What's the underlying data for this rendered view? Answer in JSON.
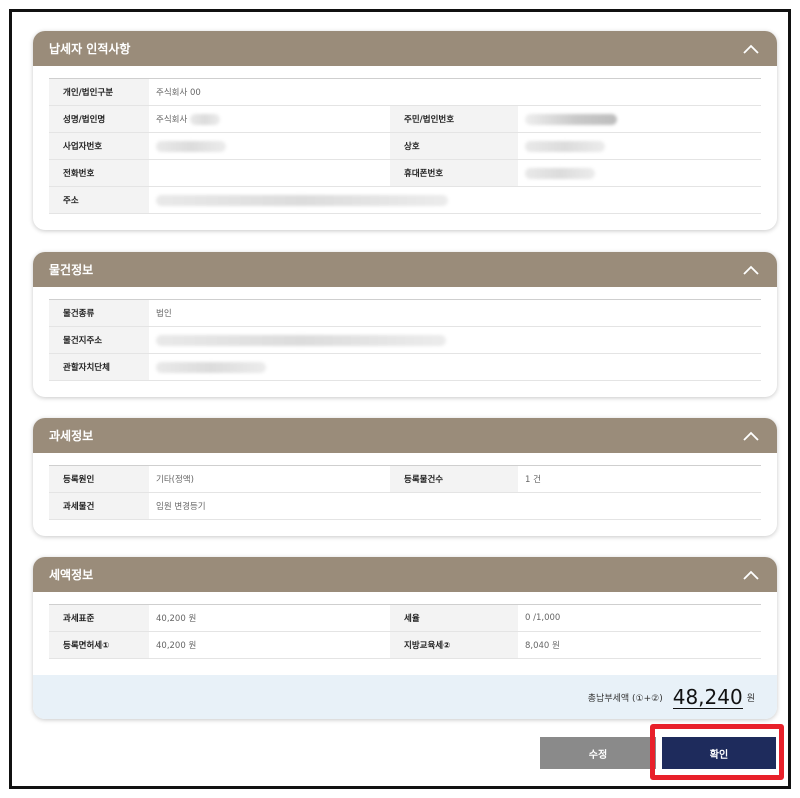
{
  "sections": {
    "taxpayer": {
      "title": "납세자 인적사항",
      "rows": {
        "type_label": "개인/법인구분",
        "type_value": "주식회사 00",
        "name_label": "성명/법인명",
        "name_value": "주식회사",
        "id_label": "주민/법인번호",
        "bizno_label": "사업자번호",
        "trade_label": "상호",
        "phone_label": "전화번호",
        "mobile_label": "휴대폰번호",
        "address_label": "주소"
      }
    },
    "property": {
      "title": "물건정보",
      "rows": {
        "kind_label": "물건종류",
        "kind_value": "법인",
        "addr_label": "물건지주소",
        "gov_label": "관할자치단체"
      }
    },
    "taxation": {
      "title": "과세정보",
      "rows": {
        "cause_label": "등록원인",
        "cause_value": "기타(정액)",
        "count_label": "등록물건수",
        "count_value": "1 건",
        "object_label": "과세물건",
        "object_value": "임원 변경등기"
      }
    },
    "amount": {
      "title": "세액정보",
      "rows": {
        "base_label": "과세표준",
        "base_value": "40,200 원",
        "rate_label": "세율",
        "rate_value": "0 /1,000",
        "reg_label": "등록면허세①",
        "reg_value": "40,200 원",
        "edu_label": "지방교육세②",
        "edu_value": "8,040 원"
      },
      "total_label": "총납부세액 (①+②)",
      "total_value": "48,240",
      "total_unit": "원"
    }
  },
  "buttons": {
    "edit": "수정",
    "confirm": "확인"
  },
  "colors": {
    "header": "#9a8c7a",
    "confirm": "#1e2b5c",
    "edit": "#8a8a8a",
    "highlight": "#e8202a"
  },
  "icons": {
    "collapse": "chevron-up-icon"
  }
}
